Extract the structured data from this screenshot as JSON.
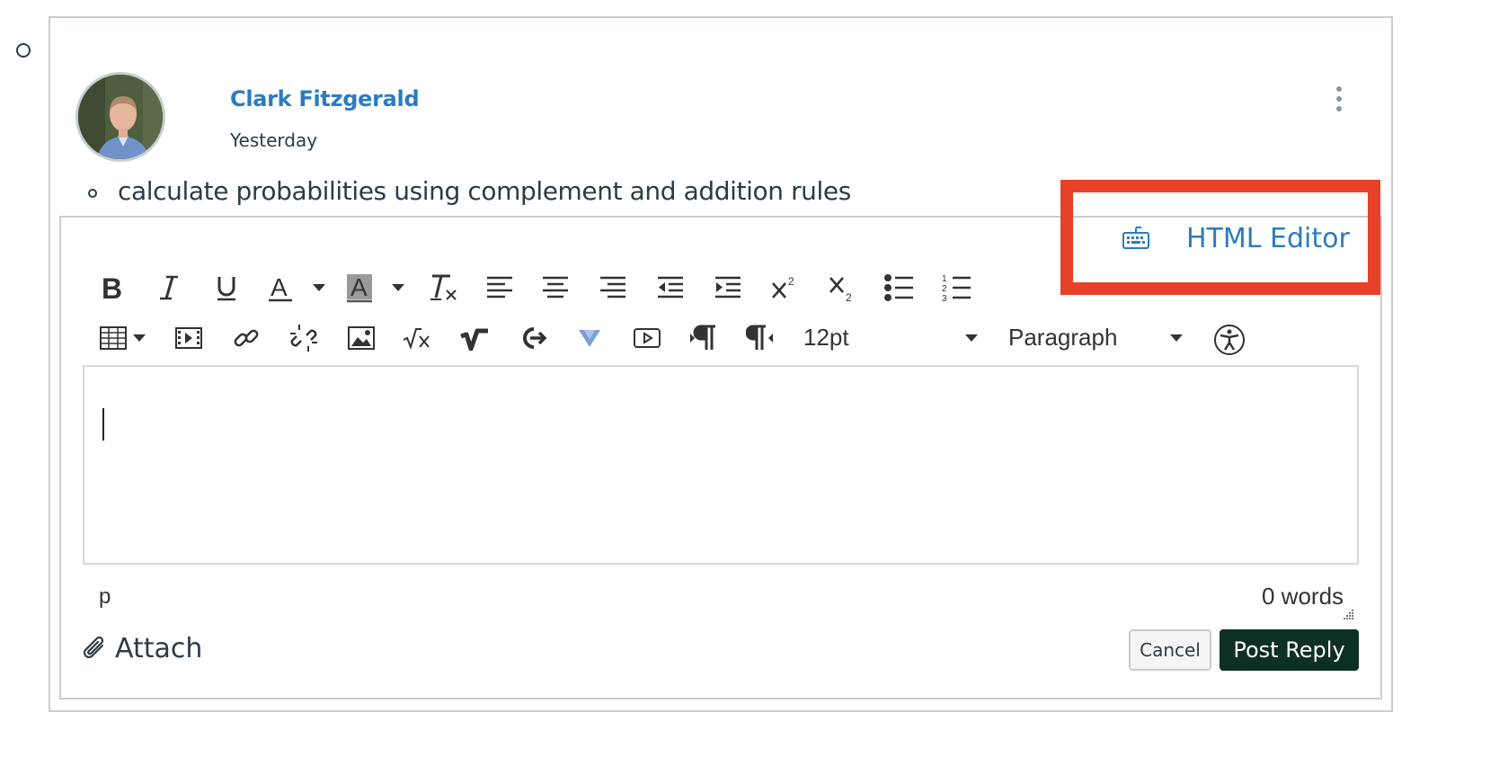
{
  "post": {
    "author": "Clark Fitzgerald",
    "date": "Yesterday",
    "quoted_item": "calculate probabilities using complement and addition rules"
  },
  "editor": {
    "html_editor_label": "HTML Editor",
    "font_size": "12pt",
    "block_format": "Paragraph",
    "status_path": "p",
    "word_count": "0 words",
    "toolbar_row1": [
      "bold-icon",
      "italic-icon",
      "underline-icon",
      "text-color-icon",
      "background-color-icon",
      "clear-formatting-icon",
      "align-left-icon",
      "align-center-icon",
      "align-right-icon",
      "outdent-icon",
      "indent-icon",
      "superscript-icon",
      "subscript-icon",
      "bullet-list-icon",
      "numbered-list-icon"
    ],
    "toolbar_row2": [
      "table-icon",
      "media-icon",
      "link-icon",
      "unlink-icon",
      "image-icon",
      "math-icon",
      "equation-icon",
      "lti-tool-icon",
      "vimeo-icon",
      "video-icon",
      "ltr-icon",
      "rtl-icon",
      "accessibility-icon"
    ]
  },
  "actions": {
    "attach_label": "Attach",
    "cancel_label": "Cancel",
    "post_label": "Post Reply"
  },
  "colors": {
    "link": "#2d7bbf",
    "highlight": "#e8412a",
    "post_button": "#0c3122"
  }
}
